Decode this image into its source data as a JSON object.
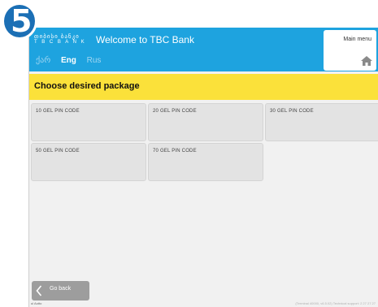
{
  "step": {
    "number": "5"
  },
  "header": {
    "logo_line1": "თიბისი ბანკი",
    "logo_line2": "T B C  B A N K",
    "welcome": "Welcome to TBC Bank",
    "languages": [
      "ქარ",
      "Eng",
      "Rus"
    ],
    "active_language": "Eng",
    "main_menu_label": "Main menu",
    "home_icon": "home-icon"
  },
  "banner": {
    "title": "Choose desired package"
  },
  "packages": [
    {
      "label": "10 GEL PIN CODE"
    },
    {
      "label": "20 GEL PIN CODE"
    },
    {
      "label": "30 GEL PIN CODE"
    },
    {
      "label": "50 GEL PIN CODE"
    },
    {
      "label": "70 GEL PIN CODE"
    }
  ],
  "footer": {
    "back_label": "Go back",
    "lang_tag": "ul Aotto",
    "info": "(Terminal 40000, v6.5.02)   Technical support: 2 27 27 27"
  },
  "colors": {
    "header_blue": "#1ea3df",
    "banner_yellow": "#fbe13a",
    "package_grey": "#e3e3e3",
    "back_grey": "#9d9d9d",
    "step_badge": "#1b6fb5"
  }
}
